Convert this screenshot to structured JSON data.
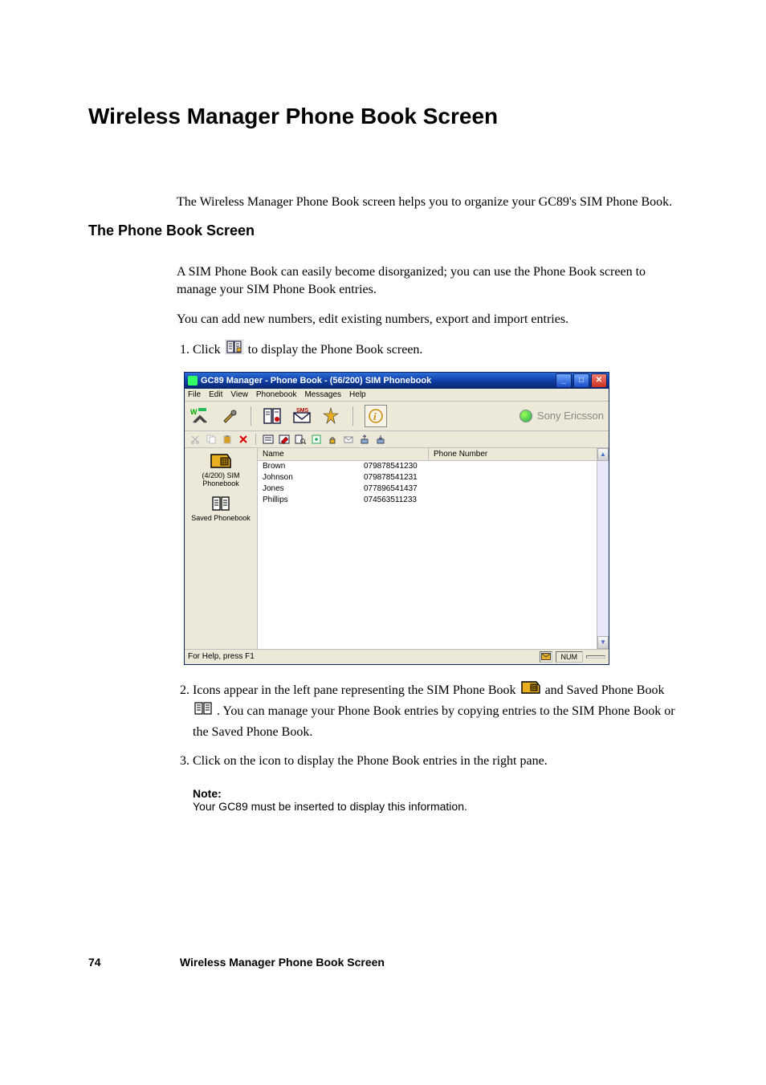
{
  "page": {
    "number": "74",
    "footer_title": "Wireless Manager Phone Book Screen"
  },
  "title": "Wireless Manager Phone Book Screen",
  "intro": "The Wireless Manager Phone Book screen helps you to organize your GC89's SIM Phone Book.",
  "section": {
    "heading": "The Phone Book Screen",
    "p1": "A SIM Phone Book can easily become disorganized; you can use the Phone Book screen to manage your SIM Phone Book entries.",
    "p2": "You can add new numbers, edit existing numbers, export and import entries."
  },
  "steps": {
    "s1_a": "Click ",
    "s1_b": " to display the Phone Book screen.",
    "s2_a": "Icons appear in the left pane representing the SIM Phone Book ",
    "s2_b": " and Saved Phone Book ",
    "s2_c": ". You can manage your Phone Book entries by copying entries to the SIM Phone Book or the Saved Phone Book.",
    "s3": "Click on the icon to display the Phone Book entries in the right pane."
  },
  "note": {
    "label": "Note:",
    "text": "Your GC89 must be inserted to display this information."
  },
  "app": {
    "title": "GC89 Manager - Phone Book - (56/200) SIM Phonebook",
    "menus": [
      "File",
      "Edit",
      "View",
      "Phonebook",
      "Messages",
      "Help"
    ],
    "brand": "Sony Ericsson",
    "left_pane": {
      "sim_label": "(4/200) SIM Phonebook",
      "saved_label": "Saved Phonebook"
    },
    "columns": {
      "name": "Name",
      "number": "Phone Number"
    },
    "rows": [
      {
        "name": "Brown",
        "number": "079878541230"
      },
      {
        "name": "Johnson",
        "number": "079878541231"
      },
      {
        "name": "Jones",
        "number": "077896541437"
      },
      {
        "name": "Phillips",
        "number": "074563511233"
      }
    ],
    "status_left": "For Help, press F1",
    "status_right": "NUM"
  }
}
